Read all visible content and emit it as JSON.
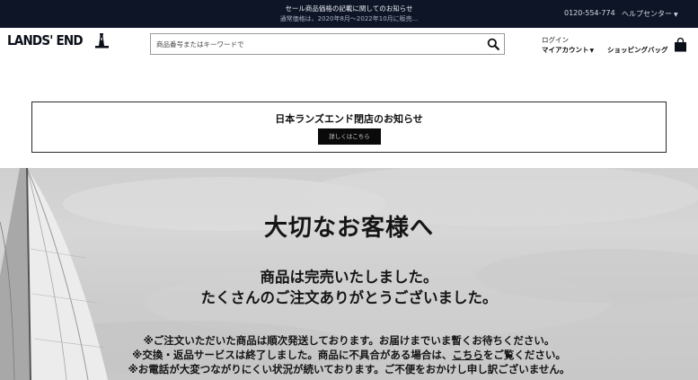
{
  "topbar": {
    "notice_line1": "セール商品価格の記載に関してのお知らせ",
    "notice_line2": "通常価格は、2020年8月～2022年10月に販売...",
    "phone": "0120-554-774",
    "help_center": "ヘルプセンター",
    "bg_color": "#0e1526"
  },
  "header": {
    "logo_text": "LANDS' END",
    "search": {
      "placeholder": "商品番号またはキーワードで",
      "icon": "search-icon"
    },
    "login": "ログイン",
    "my_account": "マイアカウント",
    "shopping_bag": "ショッピングバッグ",
    "bag_icon": "shopping-bag-icon"
  },
  "closing_notice": {
    "title": "日本ランズエンド閉店のお知らせ",
    "button": "詳しくはこちら"
  },
  "hero": {
    "title": "大切なお客様へ",
    "line1": "商品は完売いたしました。",
    "line2": "たくさんのご注文ありがとうございました。",
    "notice1": "※ご注文いただいた商品は順次発送しております。お届けまでいま暫くお待ちください。",
    "notice2_before": "※交換・返品サービスは終了しました。商品に不具合がある場合は、",
    "notice2_link": "こちら",
    "notice2_after": "をご覧ください。",
    "notice3": "※お電話が大変つながりにくい状況が続いております。ご不便をおかけし申し訳ございません。"
  }
}
